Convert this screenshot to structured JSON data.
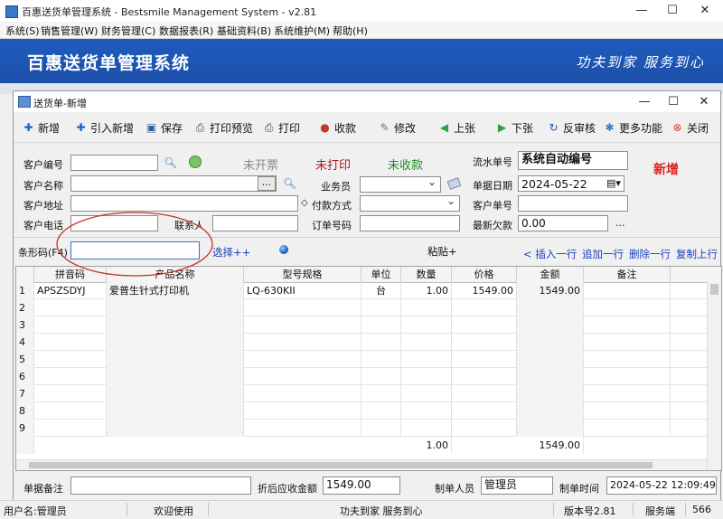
{
  "outer_window": {
    "title": "百惠送货单管理系统 - Bestsmile Management System - v2.81",
    "controls": {
      "minimize": "—",
      "maximize": "☐",
      "close": "✕"
    }
  },
  "menubar": [
    "系统(S)",
    "销售管理(W)",
    "财务管理(C)",
    "数据报表(R)",
    "基础资料(B)",
    "系统维护(M)",
    "帮助(H)"
  ],
  "banner": {
    "title": "百惠送货单管理系统",
    "slogan": "功夫到家 服务到心",
    "color": "#1f5cbf"
  },
  "dialog": {
    "title": "送货单-新增",
    "controls": {
      "minimize": "—",
      "maximize": "☐",
      "close": "✕"
    }
  },
  "toolbar": [
    {
      "label": "新增",
      "icon": "add-icon",
      "glyph": "✚",
      "color": "#1e5fd0"
    },
    {
      "label": "引入新增",
      "icon": "import-add-icon",
      "glyph": "✚",
      "color": "#1e5fd0"
    },
    {
      "label": "保存",
      "icon": "save-icon",
      "glyph": "▣",
      "color": "#2f5f9e"
    },
    {
      "label": "打印预览",
      "icon": "print-preview-icon",
      "glyph": "⎙",
      "color": "#444"
    },
    {
      "label": "打印",
      "icon": "print-icon",
      "glyph": "⎙",
      "color": "#444"
    },
    {
      "label": "收款",
      "icon": "collect-payment-icon",
      "glyph": "●",
      "color": "#c0392b"
    },
    {
      "label": "修改",
      "icon": "edit-icon",
      "glyph": "✎",
      "color": "#a0662b"
    },
    {
      "label": "上张",
      "icon": "previous-record-icon",
      "glyph": "◀",
      "color": "#2ea043"
    },
    {
      "label": "下张",
      "icon": "next-record-icon",
      "glyph": "▶",
      "color": "#2ea043"
    },
    {
      "label": "反审核",
      "icon": "unaudit-icon",
      "glyph": "↻",
      "color": "#2455a8"
    },
    {
      "label": "更多功能",
      "icon": "more-functions-icon",
      "glyph": "✱",
      "color": "#2f7fd0"
    },
    {
      "label": "关闭",
      "icon": "close-doc-icon",
      "glyph": "⊗",
      "color": "#d0392b"
    }
  ],
  "form": {
    "customer_no": {
      "label": "客户编号",
      "value": ""
    },
    "customer_name": {
      "label": "客户名称",
      "value": "",
      "browse": "..."
    },
    "customer_address": {
      "label": "客户地址",
      "value": ""
    },
    "customer_phone": {
      "label": "客户电话",
      "value": ""
    },
    "contact": {
      "label": "联系人",
      "value": ""
    },
    "salesperson": {
      "label": "业务员",
      "value": ""
    },
    "payment_method": {
      "label": "付款方式",
      "value": ""
    },
    "order_no": {
      "label": "订单号码",
      "value": ""
    },
    "serial_no": {
      "label": "流水单号",
      "value": "系统自动编号"
    },
    "doc_date": {
      "label": "单据日期",
      "value": "2024-05-22"
    },
    "customer_doc_no": {
      "label": "客户单号",
      "value": ""
    },
    "latest_debt": {
      "label": "最新欠款",
      "value": "0.00",
      "more": "..."
    },
    "status_invoice": {
      "text": "未开票",
      "color": "#8a8a8a"
    },
    "status_print": {
      "text": "未打印",
      "color": "#a31c1c"
    },
    "status_payment": {
      "text": "未收款",
      "color": "#1f8a1f"
    },
    "mode_badge": {
      "text": "新增",
      "color": "#e02020"
    },
    "barcode": {
      "label": "条形码(F4)",
      "value": ""
    },
    "select_link": "选择++",
    "paste_link": "粘贴+",
    "row_actions": [
      "< 插入一行",
      "追加一行",
      "删除一行",
      "复制上行"
    ]
  },
  "grid": {
    "columns": [
      "拼音码",
      "产品名称",
      "型号规格",
      "单位",
      "数量",
      "价格",
      "金额",
      "备注"
    ],
    "rows": [
      {
        "no": "1",
        "code": "APSZSDYJ",
        "name": "爱普生针式打印机",
        "model": "LQ-630KII",
        "unit": "台",
        "qty": "1.00",
        "price": "1549.00",
        "amount": "1549.00",
        "remark": ""
      },
      {
        "no": "2",
        "code": "",
        "name": "",
        "model": "",
        "unit": "",
        "qty": "",
        "price": "",
        "amount": "",
        "remark": ""
      },
      {
        "no": "3",
        "code": "",
        "name": "",
        "model": "",
        "unit": "",
        "qty": "",
        "price": "",
        "amount": "",
        "remark": ""
      },
      {
        "no": "4",
        "code": "",
        "name": "",
        "model": "",
        "unit": "",
        "qty": "",
        "price": "",
        "amount": "",
        "remark": ""
      },
      {
        "no": "5",
        "code": "",
        "name": "",
        "model": "",
        "unit": "",
        "qty": "",
        "price": "",
        "amount": "",
        "remark": ""
      },
      {
        "no": "6",
        "code": "",
        "name": "",
        "model": "",
        "unit": "",
        "qty": "",
        "price": "",
        "amount": "",
        "remark": ""
      },
      {
        "no": "7",
        "code": "",
        "name": "",
        "model": "",
        "unit": "",
        "qty": "",
        "price": "",
        "amount": "",
        "remark": ""
      },
      {
        "no": "8",
        "code": "",
        "name": "",
        "model": "",
        "unit": "",
        "qty": "",
        "price": "",
        "amount": "",
        "remark": ""
      },
      {
        "no": "9",
        "code": "",
        "name": "",
        "model": "",
        "unit": "",
        "qty": "",
        "price": "",
        "amount": "",
        "remark": ""
      }
    ],
    "totals": {
      "qty": "1.00",
      "amount": "1549.00"
    }
  },
  "footer": {
    "remark": {
      "label": "单据备注",
      "value": ""
    },
    "discount_total": {
      "label": "折后应收金额",
      "value": "1549.00"
    },
    "creator": {
      "label": "制单人员",
      "value": "管理员"
    },
    "create_time": {
      "label": "制单时间",
      "value": "2024-05-22 12:09:49"
    }
  },
  "statusbar": {
    "user": "用户名:管理员",
    "welcome": "欢迎使用",
    "slogan": "功夫到家 服务到心",
    "version": "版本号2.81",
    "service": "服务端",
    "port": "566"
  },
  "annotation_color": "#c0392b"
}
